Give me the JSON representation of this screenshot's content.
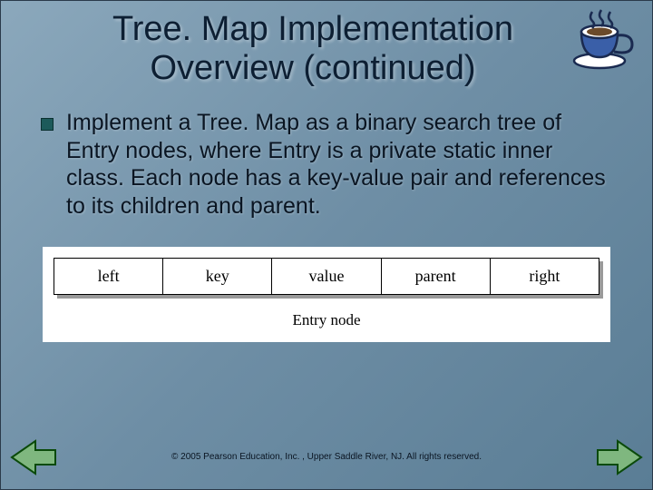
{
  "title_line1": "Tree. Map Implementation",
  "title_line2": "Overview (continued)",
  "bullet": "Implement a Tree. Map as a binary search tree of Entry nodes, where Entry is a private static inner class. Each node has a key-value pair and references to its children and parent.",
  "entry_fields": {
    "f0": "left",
    "f1": "key",
    "f2": "value",
    "f3": "parent",
    "f4": "right"
  },
  "entry_caption": "Entry node",
  "footer": "© 2005 Pearson Education, Inc. , Upper Saddle River, NJ.  All rights reserved.",
  "colors": {
    "bullet_square": "#1c5a5a",
    "arrow_fill": "#7fb77f",
    "arrow_stroke": "#0a4a0a"
  }
}
